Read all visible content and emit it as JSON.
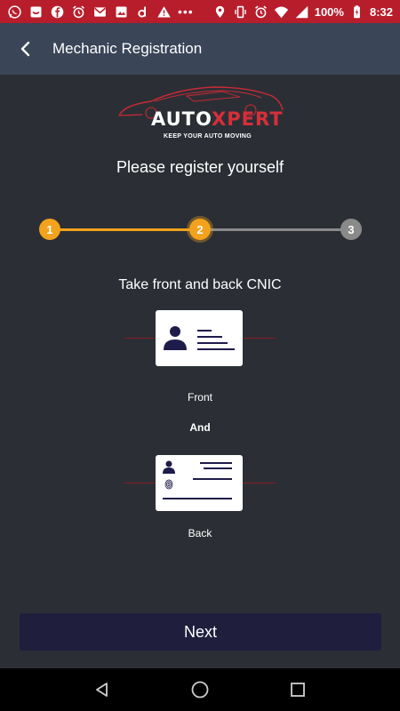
{
  "status_bar": {
    "battery": "100%",
    "time": "8:32",
    "dots": "•••",
    "icons_left": [
      "whatsapp-icon",
      "inbox-icon",
      "facebook-icon",
      "alarm-icon",
      "gmail-icon",
      "gallery-icon",
      "d-app-icon",
      "warning-icon"
    ],
    "icons_right": [
      "location-icon",
      "vibrate-icon",
      "alarm-icon",
      "wifi-icon",
      "signal-icon",
      "battery-charging-icon"
    ],
    "background": "#b81d2b"
  },
  "toolbar": {
    "title": "Mechanic Registration",
    "background": "#3a4558"
  },
  "logo": {
    "word_part1": "AUTO",
    "word_part2": "XPERT",
    "tagline": "KEEP YOUR AUTO MOVING"
  },
  "heading": "Please register yourself",
  "stepper": {
    "steps": [
      "1",
      "2",
      "3"
    ],
    "current": 2,
    "active_color": "#f2a21c",
    "inactive_color": "#8a8a8a"
  },
  "instruction": "Take front and back CNIC",
  "cards": {
    "front_label": "Front",
    "and_label": "And",
    "back_label": "Back"
  },
  "next_button": "Next",
  "colors": {
    "background": "#2b2f35",
    "button": "#1f1e3d",
    "accent_red": "#d62f3a"
  }
}
